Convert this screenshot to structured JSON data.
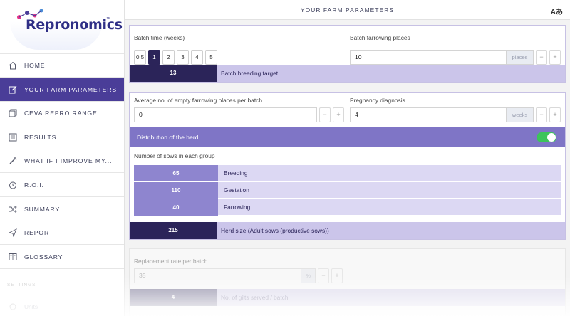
{
  "brand": {
    "name": "Repronomics",
    "tm": "™"
  },
  "header": {
    "title": "YOUR FARM PARAMETERS",
    "lang_icon": "Aあ"
  },
  "nav": [
    {
      "label": "HOME",
      "icon": "home-icon"
    },
    {
      "label": "YOUR FARM PARAMETERS",
      "icon": "edit-icon"
    },
    {
      "label": "CEVA REPRO RANGE",
      "icon": "copy-icon"
    },
    {
      "label": "RESULTS",
      "icon": "list-icon"
    },
    {
      "label": "WHAT IF I IMPROVE MY...",
      "icon": "wand-icon"
    },
    {
      "label": "R.O.I.",
      "icon": "timer-icon"
    },
    {
      "label": "SUMMARY",
      "icon": "shuffle-icon"
    },
    {
      "label": "REPORT",
      "icon": "send-icon"
    },
    {
      "label": "GLOSSARY",
      "icon": "book-icon"
    }
  ],
  "settings": {
    "title": "SETTINGS",
    "units_label": "Units"
  },
  "batch": {
    "time_label": "Batch time (weeks)",
    "options": [
      "0.5",
      "1",
      "2",
      "3",
      "4",
      "5"
    ],
    "selected": "1",
    "farrowing_label": "Batch farrowing places",
    "farrowing_value": "10",
    "farrowing_unit": "places",
    "target_value": "13",
    "target_label": "Batch breeding target"
  },
  "pregnancy": {
    "empty_label": "Average no. of empty farrowing places per batch",
    "empty_value": "0",
    "diag_label": "Pregnancy diagnosis",
    "diag_value": "4",
    "diag_unit": "weeks"
  },
  "distribution": {
    "title": "Distribution of the herd",
    "toggle_on": true,
    "groups_label": "Number of sows in each group",
    "groups": [
      {
        "value": "65",
        "label": "Breeding"
      },
      {
        "value": "110",
        "label": "Gestation"
      },
      {
        "value": "40",
        "label": "Farrowing"
      }
    ],
    "herd_value": "215",
    "herd_label": "Herd size (Adult sows (productive sows))"
  },
  "replacement": {
    "label": "Replacement rate per batch",
    "value": "35",
    "unit": "%",
    "gilts_value": "4",
    "gilts_label": "No. of gilts served / batch"
  },
  "steppers": {
    "minus": "−",
    "plus": "+"
  },
  "colors": {
    "primary_dark": "#2b2459",
    "active_nav": "#4a3d98",
    "accent_light": "#cbc5ea",
    "toggle": "#3cc45a"
  }
}
